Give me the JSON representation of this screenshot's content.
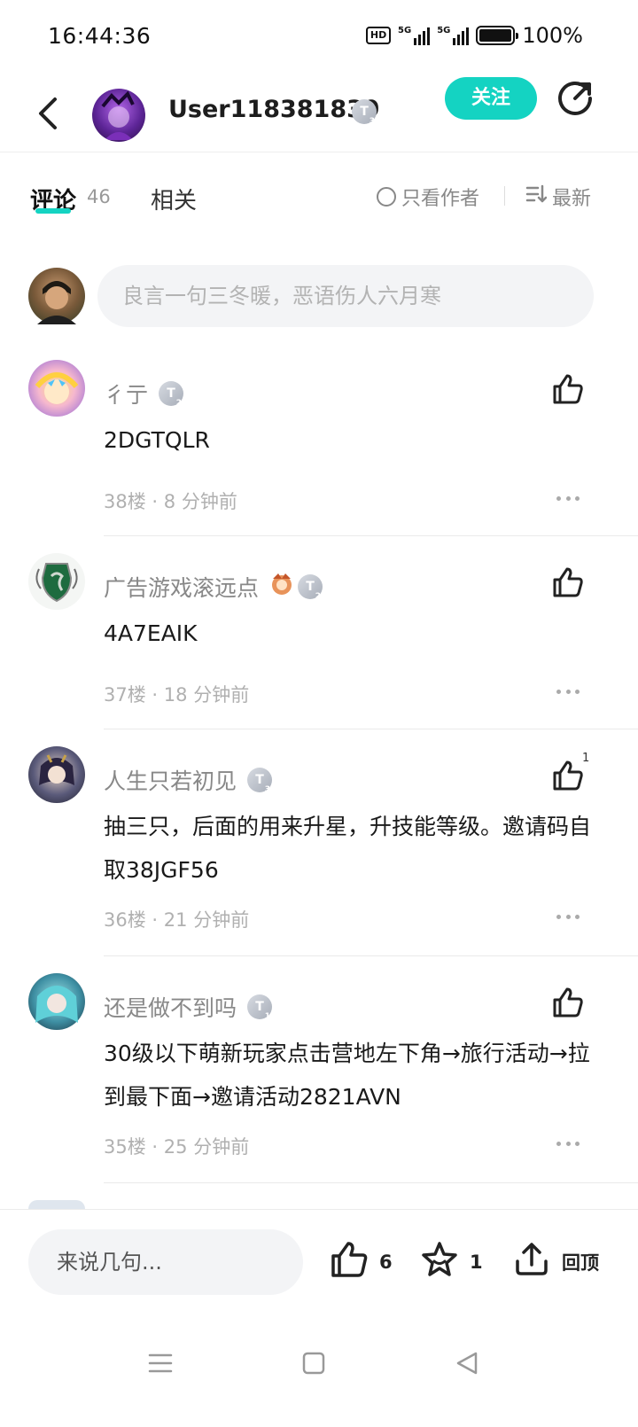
{
  "status_bar": {
    "time": "16:44:36",
    "hd": "HD",
    "net1": "5G",
    "net2": "5G",
    "battery": "100%"
  },
  "header": {
    "username": "User118381839",
    "level": "3",
    "follow_label": "关注"
  },
  "tabs": {
    "comments_label": "评论",
    "comments_count": "46",
    "related_label": "相关",
    "author_only_label": "只看作者",
    "sort_label": "最新"
  },
  "comment_input": {
    "placeholder": "良言一句三冬暖，恶语伤人六月寒"
  },
  "comments": [
    {
      "name": "彳亍",
      "level": "2",
      "text": "2DGTQLR",
      "floor": "38楼",
      "time": "8 分钟前",
      "likes": ""
    },
    {
      "name": "广告游戏滚远点",
      "level": "2",
      "text": "4A7EAIK",
      "floor": "37楼",
      "time": "18 分钟前",
      "likes": ""
    },
    {
      "name": "人生只若初见",
      "level": "3",
      "text": "抽三只，后面的用来升星，升技能等级。邀请码自取38JGF56",
      "floor": "36楼",
      "time": "21 分钟前",
      "likes": "1"
    },
    {
      "name": "还是做不到吗",
      "level": "1",
      "text": "30级以下萌新玩家点击营地左下角→旅行活动→拉到最下面→邀请活动2821AVN",
      "floor": "35楼",
      "time": "25 分钟前",
      "likes": ""
    }
  ],
  "meta_separator": "·",
  "bottom_bar": {
    "input_placeholder": "来说几句...",
    "like_count": "6",
    "fav_count": "1",
    "top_label": "回顶"
  },
  "colors": {
    "accent": "#14d3c2",
    "muted": "#888888",
    "meta": "#b0b0b0"
  },
  "icons": [
    "back-arrow-icon",
    "share-icon",
    "radio-icon",
    "sort-icon",
    "thumb-up-icon",
    "more-dots-icon",
    "star-icon",
    "upload-top-icon",
    "menu-icon",
    "home-square-icon",
    "back-triangle-icon"
  ]
}
